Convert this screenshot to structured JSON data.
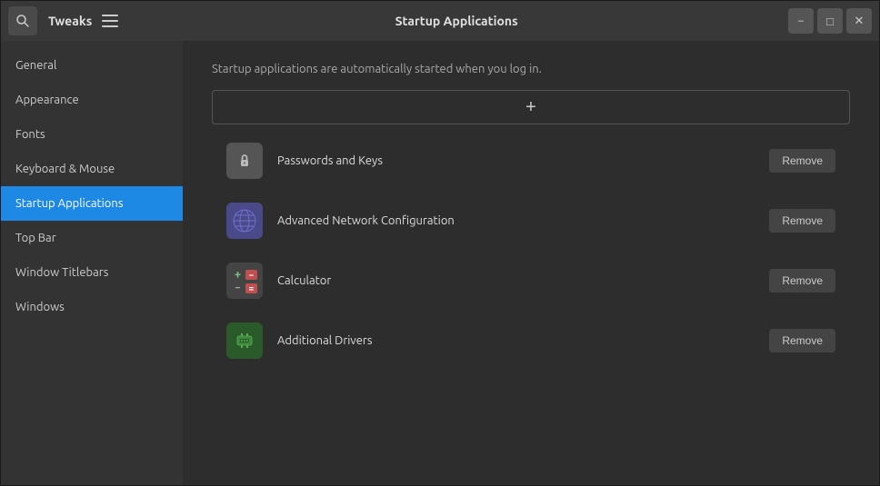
{
  "titlebar": {
    "app_name": "Tweaks",
    "window_title": "Startup Applications",
    "minimize_label": "−",
    "maximize_label": "□",
    "close_label": "✕"
  },
  "sidebar": {
    "items": [
      {
        "id": "general",
        "label": "General",
        "active": false
      },
      {
        "id": "appearance",
        "label": "Appearance",
        "active": false
      },
      {
        "id": "fonts",
        "label": "Fonts",
        "active": false
      },
      {
        "id": "keyboard-mouse",
        "label": "Keyboard & Mouse",
        "active": false
      },
      {
        "id": "startup-applications",
        "label": "Startup Applications",
        "active": true
      },
      {
        "id": "top-bar",
        "label": "Top Bar",
        "active": false
      },
      {
        "id": "window-titlebars",
        "label": "Window Titlebars",
        "active": false
      },
      {
        "id": "windows",
        "label": "Windows",
        "active": false
      }
    ]
  },
  "content": {
    "description": "Startup applications are automatically started when you log in.",
    "add_button_label": "+",
    "apps": [
      {
        "id": "passwords",
        "name": "Passwords and Keys",
        "remove_label": "Remove"
      },
      {
        "id": "network",
        "name": "Advanced Network Configuration",
        "remove_label": "Remove"
      },
      {
        "id": "calculator",
        "name": "Calculator",
        "remove_label": "Remove"
      },
      {
        "id": "drivers",
        "name": "Additional Drivers",
        "remove_label": "Remove"
      }
    ]
  }
}
